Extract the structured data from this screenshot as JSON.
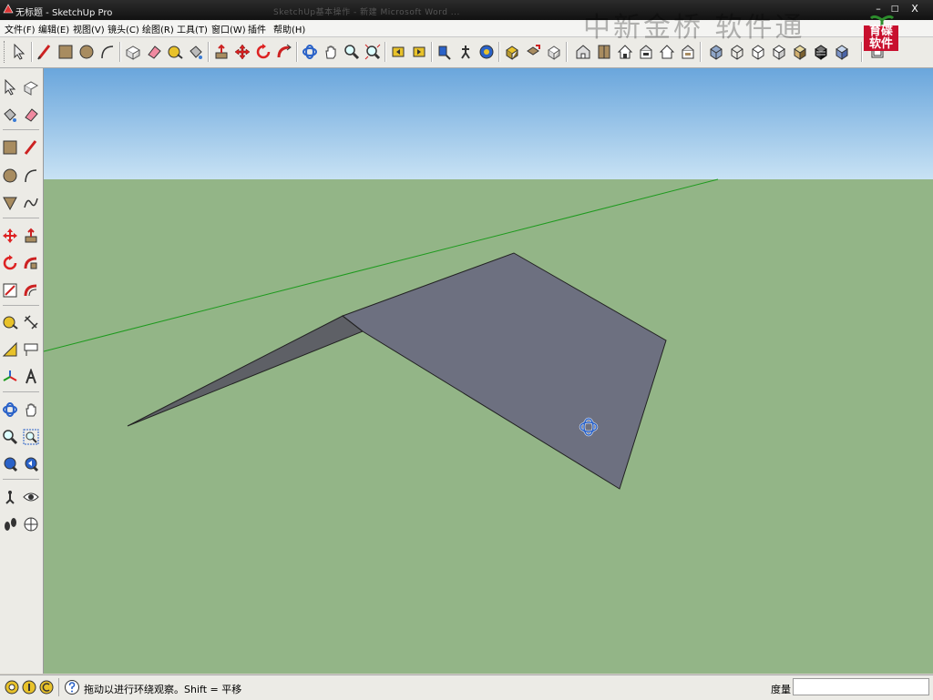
{
  "window": {
    "title": "无标题 - SketchUp Pro",
    "background_tabs": "SketchUp基本操作 - 新建 Microsoft Word ...",
    "controls": [
      "–",
      "□",
      "X"
    ]
  },
  "menu": [
    {
      "label": "文件(F)"
    },
    {
      "label": "编辑(E)"
    },
    {
      "label": "视图(V)"
    },
    {
      "label": "镜头(C)"
    },
    {
      "label": "绘图(R)"
    },
    {
      "label": "工具(T)"
    },
    {
      "label": "窗口(W)"
    },
    {
      "label": "插件"
    },
    {
      "label": "帮助(H)"
    }
  ],
  "overlay": {
    "watermark": "中新金桥 软件通",
    "logo_text_top": "育碟",
    "logo_text_bottom": "软件"
  },
  "toolbar_icons": [
    "select-icon",
    "pencil-icon",
    "rectangle-icon",
    "circle-icon",
    "arc-icon",
    "make-component-icon",
    "eraser-icon",
    "tape-measure-icon",
    "paint-bucket-icon",
    "push-pull-icon",
    "move-icon",
    "rotate-icon",
    "follow-me-icon",
    "orbit-icon",
    "pan-icon",
    "zoom-icon",
    "zoom-extents-icon",
    "previous-view-icon",
    "next-view-icon",
    "position-camera-icon",
    "walk-icon",
    "look-around-icon",
    "get-models-icon",
    "share-model-icon",
    "share-component-icon",
    "send-to-layout-icon",
    "iso-view-icon",
    "top-view-icon",
    "front-view-icon",
    "right-view-icon",
    "back-view-icon",
    "left-view-icon",
    "xray-icon",
    "wireframe-icon",
    "hidden-line-icon",
    "shaded-icon",
    "shaded-textures-icon",
    "monochrome-icon",
    "layer-icon"
  ],
  "left_tools": [
    [
      "select-icon",
      "make-component-icon"
    ],
    [
      "paint-bucket-icon",
      "eraser-icon"
    ],
    [
      "rectangle-icon",
      "line-icon"
    ],
    [
      "circle-icon",
      "arc-icon"
    ],
    [
      "polygon-icon",
      "freehand-icon"
    ],
    [
      "move-icon",
      "push-pull-icon"
    ],
    [
      "rotate-icon",
      "follow-me-icon"
    ],
    [
      "scale-icon",
      "offset-icon"
    ],
    [
      "tape-measure-icon",
      "dimension-icon"
    ],
    [
      "protractor-icon",
      "text-icon"
    ],
    [
      "axes-icon",
      "3d-text-icon"
    ],
    [
      "orbit-icon",
      "pan-icon"
    ],
    [
      "zoom-icon",
      "zoom-window-icon"
    ],
    [
      "zoom-extents-icon",
      "previous-view-icon"
    ],
    [
      "position-camera-icon",
      "look-around-icon"
    ],
    [
      "walk-icon",
      "section-plane-icon"
    ]
  ],
  "status": {
    "hint": "拖动以进行环绕观察。Shift = 平移",
    "measurement_label": "度量",
    "measurement_value": ""
  },
  "colors": {
    "sky_top": "#6aa6dc",
    "sky_bottom": "#c8e2f4",
    "ground": "#93b587",
    "face": "#6d7080",
    "axis_green": "#1e9a1e"
  }
}
